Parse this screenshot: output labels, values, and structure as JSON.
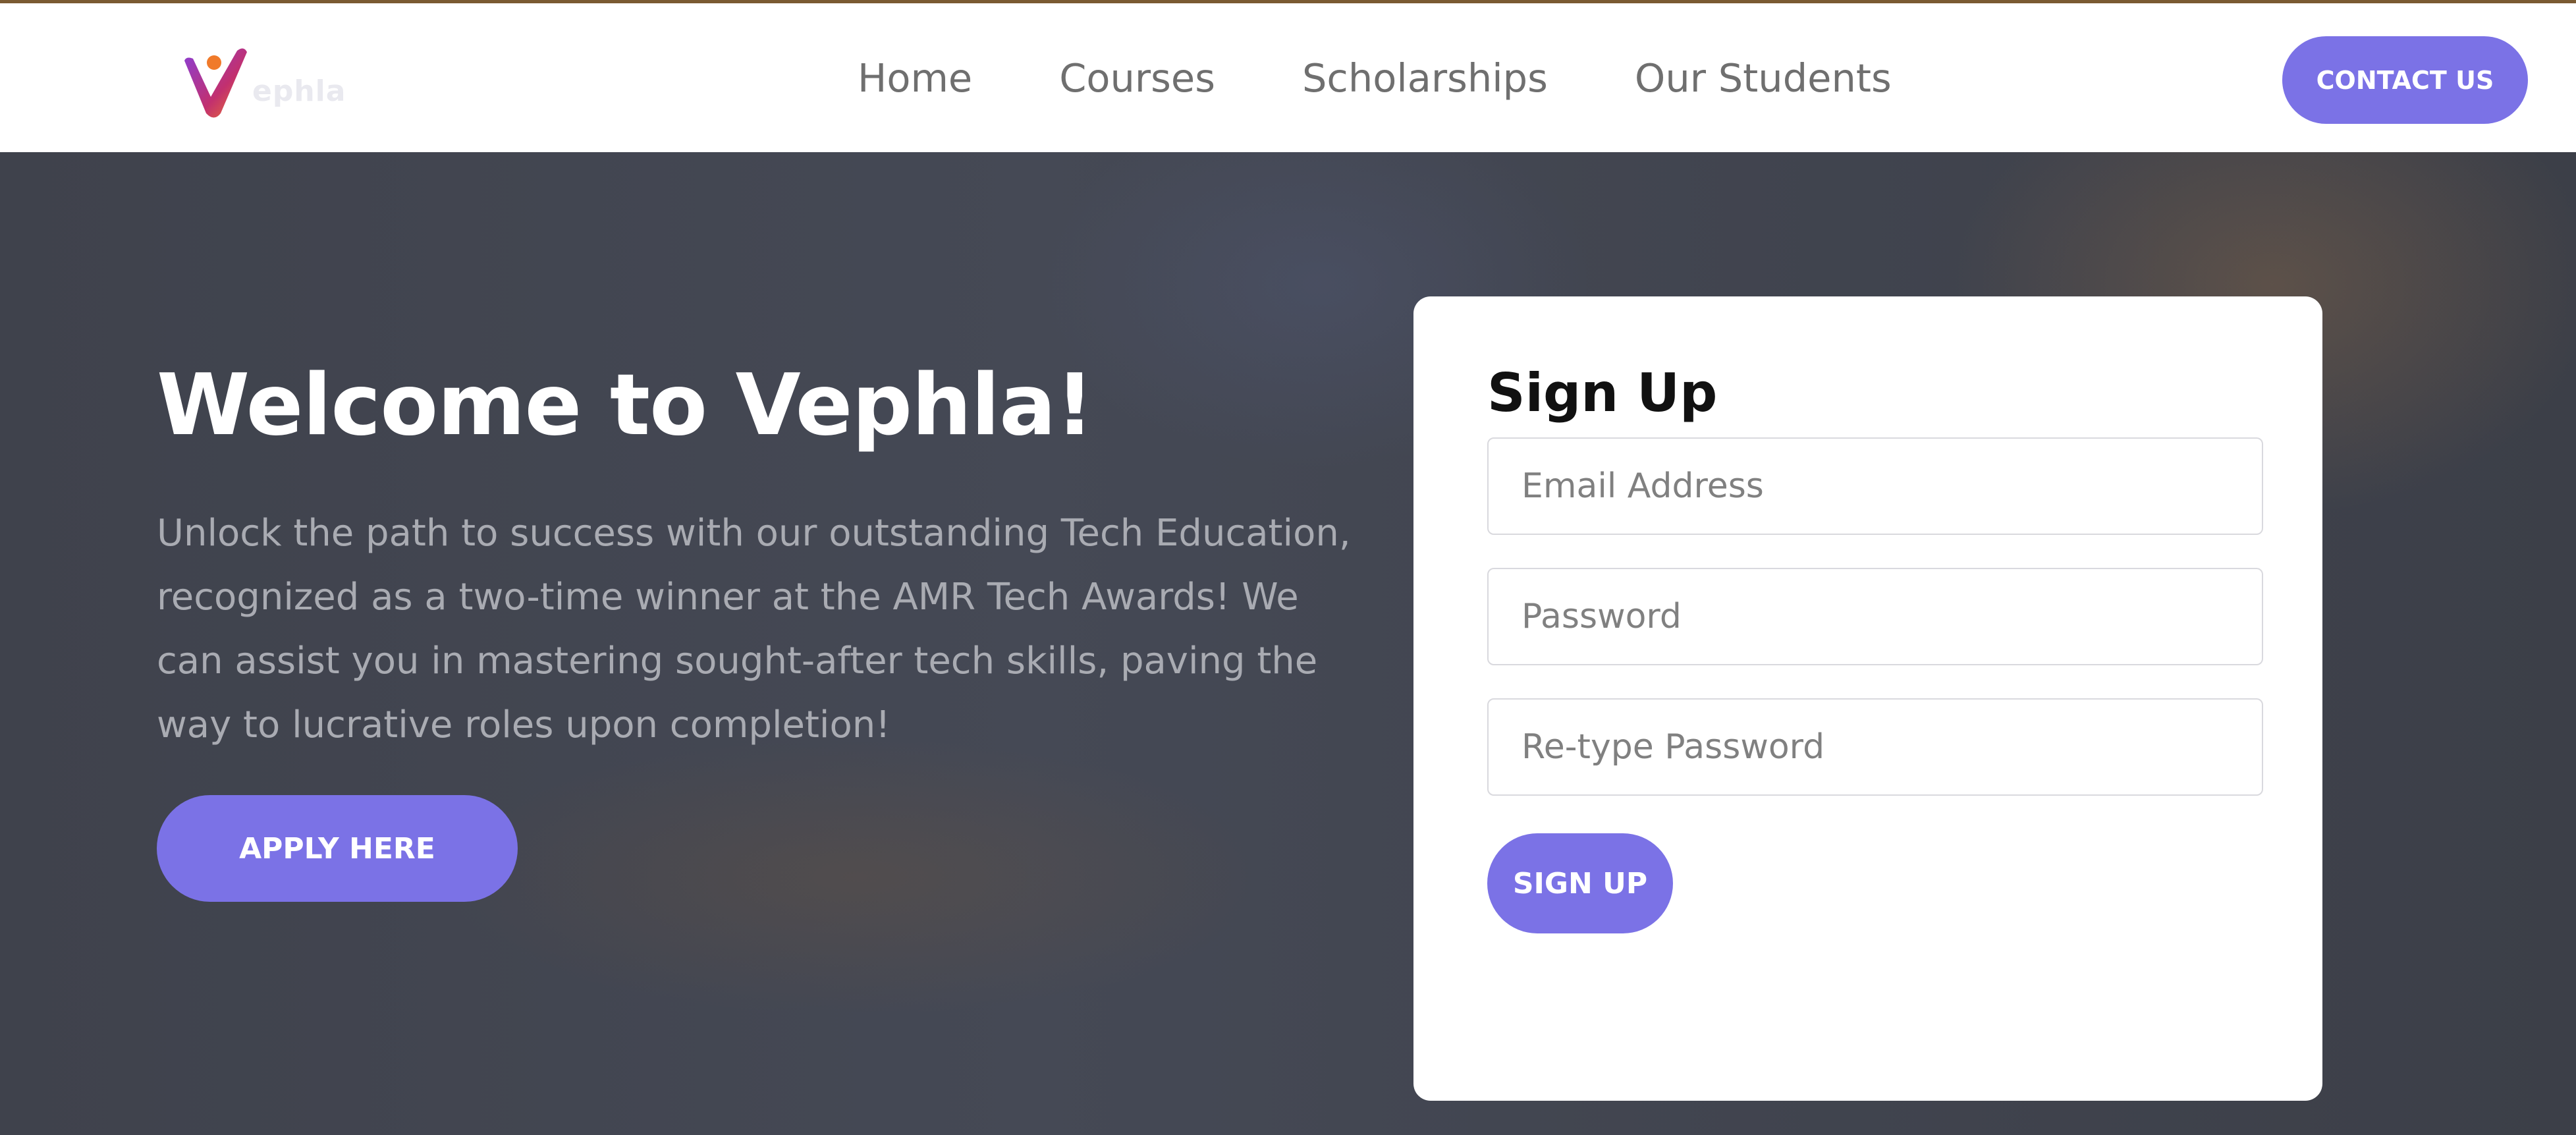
{
  "brand": {
    "logo_text": "ephla",
    "accent_color": "#7b72e6"
  },
  "nav": {
    "items": [
      {
        "label": "Home"
      },
      {
        "label": "Courses"
      },
      {
        "label": "Scholarships"
      },
      {
        "label": "Our Students"
      }
    ],
    "contact_label": "CONTACT US"
  },
  "hero": {
    "title": "Welcome to Vephla!",
    "text": "Unlock the path to success with our outstanding Tech Education, recognized as a two-time winner at the AMR Tech Awards! We can assist you in mastering sought-after tech skills, paving the way to lucrative roles upon completion!",
    "apply_label": "APPLY HERE"
  },
  "signup": {
    "title": "Sign Up",
    "email_placeholder": "Email Address",
    "password_placeholder": "Password",
    "retype_placeholder": "Re-type Password",
    "button_label": "SIGN UP"
  }
}
